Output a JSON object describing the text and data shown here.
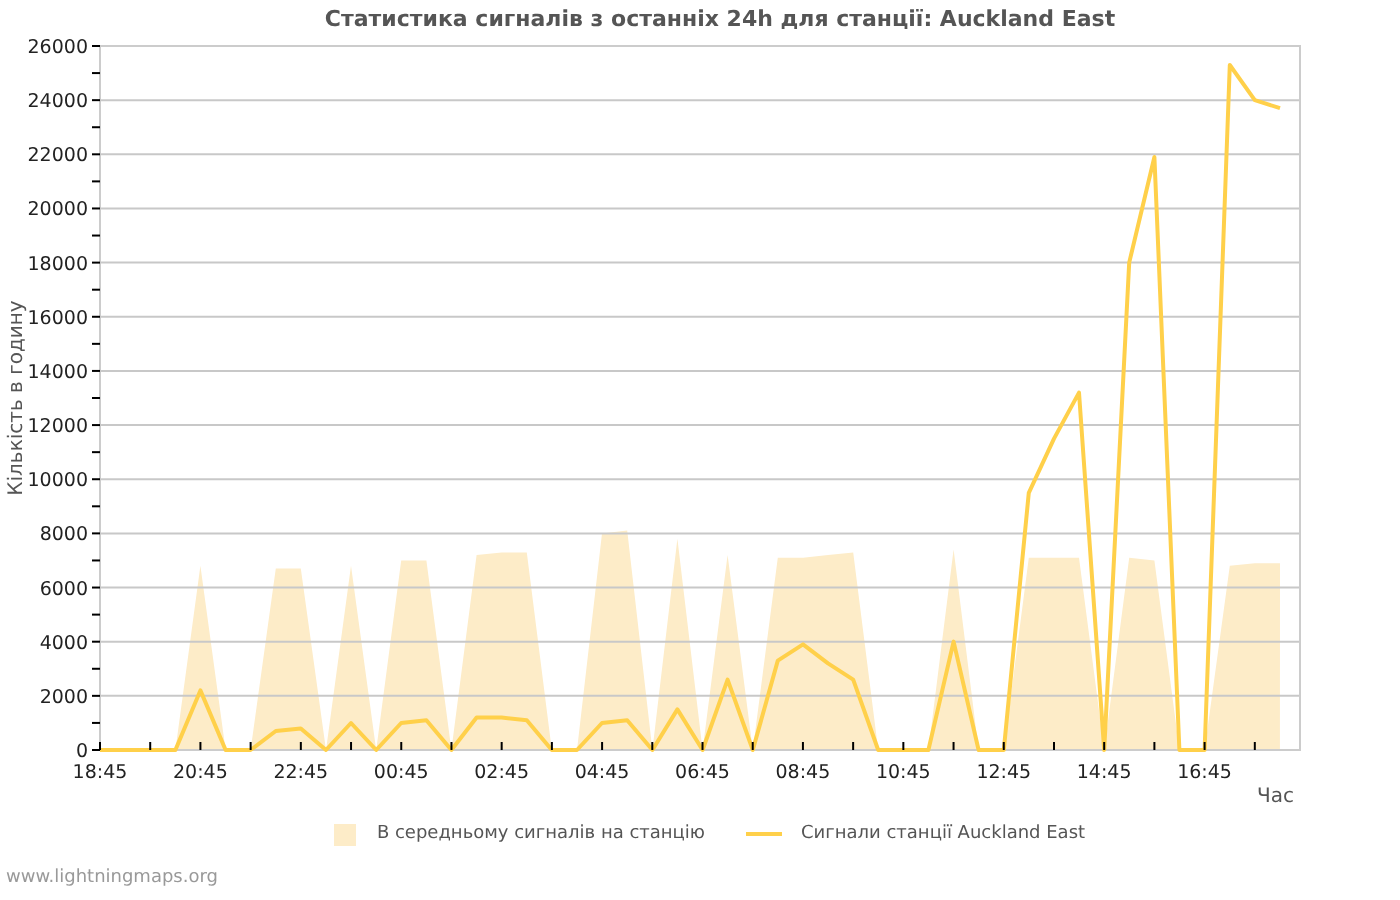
{
  "title": "Статистика сигналів з останніх 24h для станції: Auckland East",
  "chart_data": {
    "type": "area",
    "xlabel": "Час",
    "ylabel": "Кількість в годину",
    "ylim": [
      0,
      26000
    ],
    "grid": true,
    "categories": [
      "18:45",
      null,
      null,
      null,
      "20:45",
      null,
      null,
      null,
      "22:45",
      null,
      null,
      null,
      "00:45",
      null,
      null,
      null,
      "02:45",
      null,
      null,
      null,
      "04:45",
      null,
      null,
      null,
      "06:45",
      null,
      null,
      null,
      "08:45",
      null,
      null,
      null,
      "10:45",
      null,
      null,
      null,
      "12:45",
      null,
      null,
      null,
      "14:45",
      null,
      null,
      null,
      "16:45",
      null,
      null,
      null
    ],
    "yticks": [
      0,
      2000,
      4000,
      6000,
      8000,
      10000,
      12000,
      14000,
      16000,
      18000,
      20000,
      22000,
      24000,
      26000
    ],
    "series": [
      {
        "name": "В середньому сигналів на станцію",
        "color": "#fdecc8",
        "values": [
          0,
          0,
          0,
          0,
          6800,
          0,
          0,
          6700,
          6700,
          0,
          6800,
          0,
          7000,
          7000,
          0,
          7200,
          7300,
          7300,
          0,
          0,
          8000,
          8100,
          0,
          7800,
          0,
          7200,
          0,
          7100,
          7100,
          7200,
          7300,
          0,
          0,
          0,
          7400,
          0,
          0,
          7100,
          7100,
          7100,
          0,
          7100,
          7000,
          0,
          0,
          6800,
          6900,
          6900
        ]
      },
      {
        "name": "Сигнали станції Auckland East",
        "type": "line",
        "color": "#ffd04a",
        "values": [
          0,
          0,
          0,
          0,
          2200,
          0,
          0,
          700,
          800,
          0,
          1000,
          0,
          1000,
          1100,
          0,
          1200,
          1200,
          1100,
          0,
          0,
          1000,
          1100,
          0,
          1500,
          0,
          2600,
          0,
          3300,
          3900,
          3200,
          2600,
          0,
          0,
          0,
          4000,
          0,
          0,
          9500,
          11500,
          13200,
          0,
          18000,
          21900,
          0,
          0,
          25300,
          24000,
          23700
        ]
      }
    ]
  },
  "footer": "www.lightningmaps.org"
}
